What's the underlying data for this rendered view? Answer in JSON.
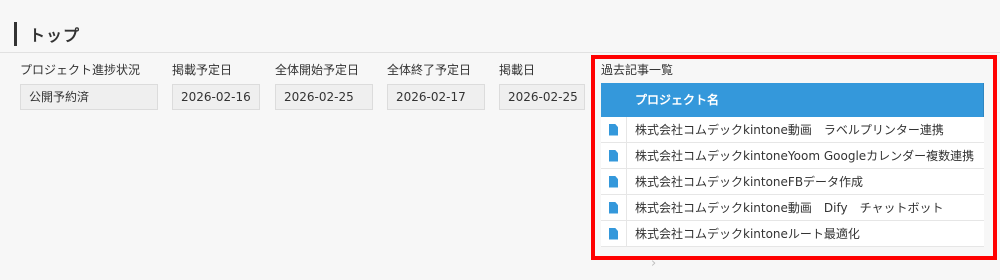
{
  "section": {
    "title": "トップ"
  },
  "fields": [
    {
      "label": "プロジェクト進捗状況",
      "value": "公開予約済"
    },
    {
      "label": "掲載予定日",
      "value": "2026-02-16"
    },
    {
      "label": "全体開始予定日",
      "value": "2026-02-25"
    },
    {
      "label": "全体終了予定日",
      "value": "2026-02-17"
    },
    {
      "label": "掲載日",
      "value": "2026-02-25"
    }
  ],
  "related": {
    "label": "過去記事一覧",
    "column_header": "プロジェクト名",
    "rows": [
      "株式会社コムデックkintone動画　ラベルプリンター連携",
      "株式会社コムデックkintoneYoom Googleカレンダー複数連携",
      "株式会社コムデックkintoneFBデータ作成",
      "株式会社コムデックkintone動画　Dify　チャットボット",
      "株式会社コムデックkintoneルート最適化"
    ]
  },
  "colors": {
    "accent": "#3498db",
    "highlight_border": "#ff0000"
  },
  "icons": {
    "row_icon": "document-icon",
    "pager": "chevron-right-icon"
  }
}
